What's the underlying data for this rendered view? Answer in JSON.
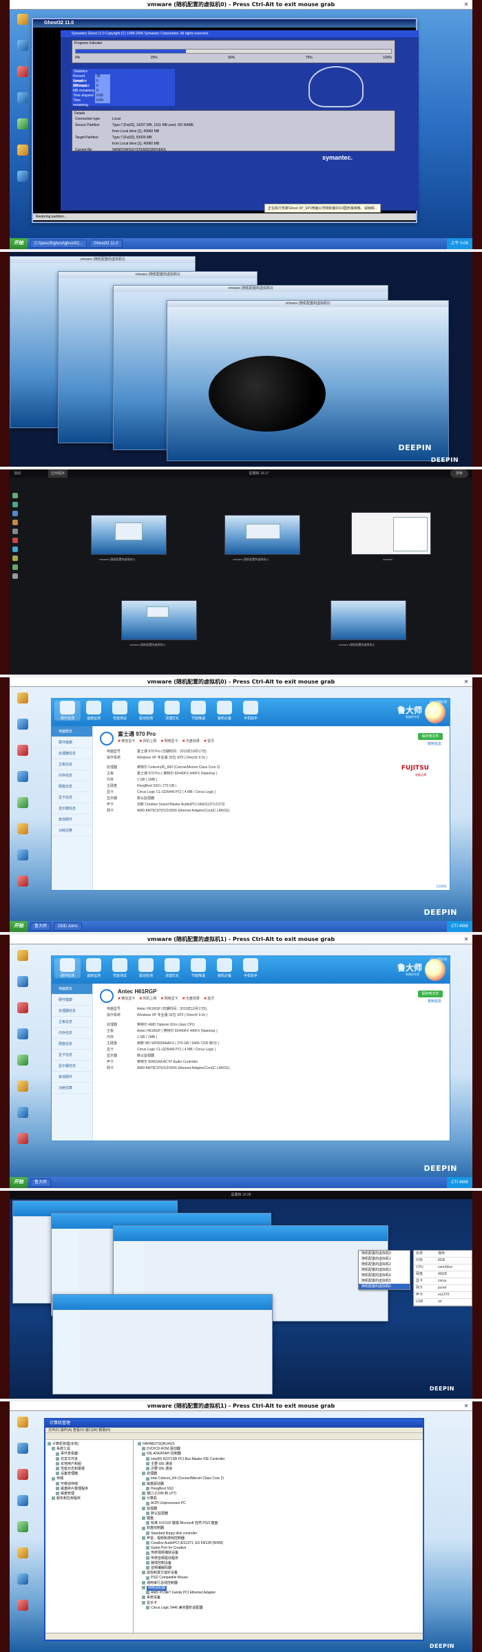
{
  "panel1": {
    "vm_title": "vmware (随机配置的虚拟机0) - Press Ctrl-Alt to exit mouse grab",
    "ghost_title": "Ghost32 11.0",
    "header_line": "Symantec Ghost 11.0   Copyright (C) 1998-2006 Symantec Corporation. All rights reserved.",
    "progress_label": "Progress Indicator",
    "progress_fraction": 0.35,
    "ticks": [
      "0%",
      "25%",
      "50%",
      "75%",
      "100%"
    ],
    "stats_label": "Statistics",
    "stats": [
      {
        "k": "Percent complete",
        "v": "35"
      },
      {
        "k": "Speed (MB/min)",
        "v": "0"
      },
      {
        "k": "MB copied",
        "v": "0"
      },
      {
        "k": "MB remaining",
        "v": "0"
      },
      {
        "k": "Time elapsed",
        "v": "0:00"
      },
      {
        "k": "Time remaining",
        "v": "0:00"
      }
    ],
    "details_label": "Details",
    "details": [
      {
        "k": "Connection type",
        "v": "Local"
      },
      {
        "k": "Source Partition",
        "v": "Type:7 [Fat32], 14267 MB, 1011 MB used, NO NAME"
      },
      {
        "k": "",
        "v": "from Local drive [1], 40960 MB"
      },
      {
        "k": "Target Partition",
        "v": "Type:7 [Fat32], 53005 MB"
      },
      {
        "k": "",
        "v": "from Local drive [1], 40960 MB"
      },
      {
        "k": "Current file",
        "v": "\\WINDOWS\\SYSTEM32\\DRIVERS"
      }
    ],
    "symantec": "symantec.",
    "restoring": "Restoring partition...",
    "notice": "正在执行恢复Ghost XP_SP3电脑公司特别版2010国庆版映像，请稍候...",
    "taskbar": {
      "start": "开始",
      "items": [
        "C:\\\\pesoft\\ghost\\ghost32...",
        "Ghost32 11.0"
      ],
      "time": "上午 0:06"
    }
  },
  "panel2": {
    "window_title": "vmware (随机配置的虚拟机0)",
    "brand": "DEEPIN"
  },
  "panel3": {
    "topbar_left": "活动",
    "topbar_app": "应用程序",
    "clock": "星期四 16:17",
    "search": "搜索",
    "captions": [
      "vmware (随机配置的虚拟机0)",
      "vmware (随机配置的虚拟机1)",
      "vmware",
      "vmware (随机配置的虚拟机2)",
      "vmware (随机配置的虚拟机3)"
    ]
  },
  "panel4": {
    "vm_title": "vmware (随机配置的虚拟机0) - Press Ctrl-Alt to exit mouse grab",
    "app_brand": "鲁大师",
    "app_sub": "系统的专家",
    "top_menu": "论坛  问题反馈",
    "tools": [
      "硬件检测",
      "温度监测",
      "性能测试",
      "驱动检测",
      "清理优化",
      "节能降温",
      "装机必备",
      "手机助手"
    ],
    "side": [
      "电脑概览",
      "硬件健康",
      "处理器信息",
      "主板信息",
      "内存信息",
      "硬盘信息",
      "显卡信息",
      "显示器信息",
      "其他硬件",
      "功耗估算"
    ],
    "pc_name": "富士通 970 Pro",
    "badges": [
      "微信显卡",
      "风机上网",
      "网络显卡",
      "光盘刻录",
      "蓝牙"
    ],
    "action": "复制信息",
    "action2": "保存到文件",
    "spec": [
      {
        "k": "电脑型号",
        "v": "富士通 970 Pro  (日期时间：2013年10月17日)"
      },
      {
        "k": "操作系统",
        "v": "Windows XP 专业版 32位 SP3 ( DirectX 9.0c )"
      },
      {
        "k": "",
        "v": ""
      },
      {
        "k": "处理器",
        "v": "英特尔 Celeron(R)_660 (Conroe/Merom Class Core 2)"
      },
      {
        "k": "主板",
        "v": "富士通 970 Pro ( 英特尔 82440FX 440FX (Natoma) )"
      },
      {
        "k": "内存",
        "v": "1 GB ( 1MB )"
      },
      {
        "k": "主硬盘",
        "v": "HongBest SS3 ( 270 GB )"
      },
      {
        "k": "显卡",
        "v": "Cirrus Logic CL-GD5446 PCI ( 4 MB / Cirrus Logic )"
      },
      {
        "k": "显示器",
        "v": "默认监视器"
      },
      {
        "k": "声卡",
        "v": "创新 Creative Sound Blaster Audio(PCI 64(ES1371/1373)"
      },
      {
        "k": "网卡",
        "v": "AMD AM79C970/1/2/3/5/6 Ethernet Adapter(Cont)C LANCE)"
      }
    ],
    "vendor": "FUJITSU",
    "vendor_sub": "电脑品牌",
    "footer": "立即更新",
    "taskbar": {
      "start": "开始",
      "items": [
        "鲁大师",
        "DDD Joins"
      ],
      "time": "CTI 4866"
    },
    "brand": "DEEPIN"
  },
  "panel5": {
    "vm_title": "vmware (随机配置的虚拟机1) - Press Ctrl-Alt to exit mouse grab",
    "pc_name": "Antec H61RGP",
    "badges": [
      "微信显卡",
      "风机上网",
      "网络显卡",
      "光盘刻录",
      "蓝牙"
    ],
    "spec": [
      {
        "k": "电脑型号",
        "v": "Antec H61RGP  (日期时间：2013年10月17日)"
      },
      {
        "k": "操作系统",
        "v": "Windows XP 专业版 32位 SP3 ( DirectX 9.0c )"
      },
      {
        "k": "",
        "v": ""
      },
      {
        "k": "处理器",
        "v": "英特尔 AMD Opteron 62xx class CPU"
      },
      {
        "k": "主板",
        "v": "Antec H61RGP ( 英特尔 82440FX 440FX (Natoma) )"
      },
      {
        "k": "内存",
        "v": "1 GB ( 1MB )"
      },
      {
        "k": "主硬盘",
        "v": "西数 WD WD5000AAKX ( 270 GB / 5400-7200 转/分 )"
      },
      {
        "k": "显卡",
        "v": "Cirrus Logic CL-GD5446 PCI ( 4 MB / Cirrus Logic )"
      },
      {
        "k": "显示器",
        "v": "默认监视器"
      },
      {
        "k": "声卡",
        "v": "英特尔 82801AA AC'97 Audio Controller"
      },
      {
        "k": "网卡",
        "v": "AMD AM79C970/1/2/3/5/6 Ethernet Adapter(Cont)C LANCE)"
      }
    ],
    "brand": "DEEPIN"
  },
  "panel6": {
    "clock": "星期四 16:28",
    "ctx_items": [
      "随机配置的虚拟机0",
      "随机配置的虚拟机1",
      "随机配置的虚拟机2",
      "随机配置的虚拟机3",
      "随机配置的虚拟机4",
      "随机配置的虚拟机5",
      "随机配置的虚拟机6"
    ],
    "ctx_highlight": 6,
    "side_list": [
      {
        "k": "名称",
        "v": "保存"
      },
      {
        "k": "内存",
        "v": "8GB"
      },
      {
        "k": "CPU",
        "v": "core2duo"
      },
      {
        "k": "硬盘",
        "v": "40GB"
      },
      {
        "k": "显卡",
        "v": "cirrus"
      },
      {
        "k": "网卡",
        "v": "pcnet"
      },
      {
        "k": "声卡",
        "v": "es1370"
      },
      {
        "k": "USB",
        "v": "on"
      }
    ],
    "brand": "DEEPIN"
  },
  "panel7": {
    "vm_title": "vmware (随机配置的虚拟机1) - Press Ctrl-Alt to exit mouse grab",
    "dm_title": "计算机管理",
    "menu": "文件(F)  操作(A)  查看(V)  窗口(W)  帮助(H)",
    "left_tree": [
      "计算机管理(本地)",
      "  系统工具",
      "    事件查看器",
      "    共享文件夹",
      "    本地用户和组",
      "    性能日志和警报",
      "    设备管理器",
      "  存储",
      "    可移动存储",
      "    磁盘碎片整理程序",
      "    磁盘管理",
      "  服务和应用程序"
    ],
    "right_tree": [
      "HAHN8JTSQHU4US",
      "  DVD/CD-ROM 驱动器",
      "  IDE ATA/ATAPI 控制器",
      "    Intel(R) 82371SB PCI Bus Master IDE Controller",
      "    主要 IDE 通道",
      "    次要 IDE 通道",
      "  处理器",
      "    Intel Celeron_R4 (Conroe/Merom Class Core 2)",
      "  磁盘驱动器",
      "    HongBest SS3",
      "  端口 (COM 和 LPT)",
      "  计算机",
      "    ACPI Uniprocessor PC",
      "  监视器",
      "    默认监视器",
      "  键盘",
      "    标准 101/102 键或 Microsoft 自然 PS/2 键盘",
      "  软盘控制器",
      "    Standard floppy disk controller",
      "  声音、视频和游戏控制器",
      "    Creative AudioPCI (ES1371, ES 64/128 (WDM)",
      "    Game Port for Creative",
      "    传统视频捕获设备",
      "    传统音频驱动程序",
      "    媒体控制设备",
      "    音频编解码器",
      "  鼠标和其它指针设备",
      "    PS/2 Compatible Mouse",
      "  通用串行总线控制器",
      "  网络适配器",
      "    AMD PCNET Family PCI Ethernet Adapter",
      "  系统设备",
      "  显示卡",
      "    Cirrus Logic 5446 兼容图形适配器"
    ],
    "selected_index": 29,
    "brand": "DEEPIN"
  }
}
